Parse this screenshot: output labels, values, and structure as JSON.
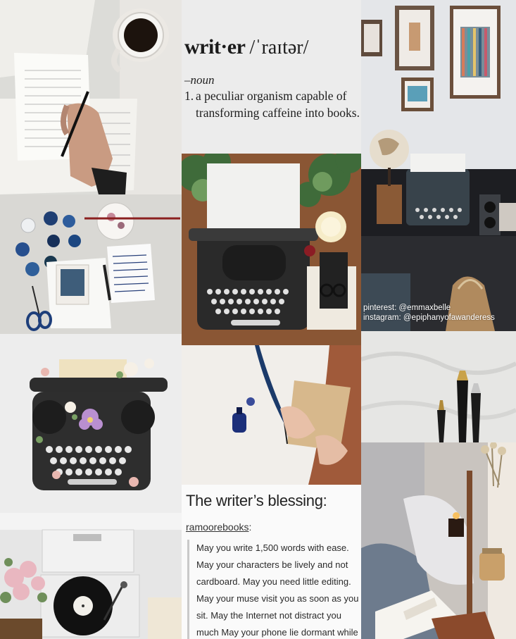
{
  "definition": {
    "word": "writ·er",
    "pronunciation": "/ˈraɪtər/",
    "part_of_speech": "–noun",
    "number": "1.",
    "text": "a peculiar organism capable of transforming caffeine into books."
  },
  "blessing": {
    "title": "The writer’s blessing:",
    "username": "ramoorebooks",
    "colon": ":",
    "quote": "May you write 1,500 words with ease. May your characters be lively and not cardboard. May you need little editing. May your muse visit you as soon as you sit. May the Internet not distract you much May your phone lie dormant while"
  },
  "watermark": {
    "pinterest": "pinterest: @emmaxbelle",
    "instagram": "instagram: @epiphanyofawanderess"
  },
  "colors": {
    "page_bg": "#f4f3f1",
    "wood": "#7b4a2c",
    "typewriter": "#2b2b2b",
    "ink_blue": "#1f3d73"
  }
}
